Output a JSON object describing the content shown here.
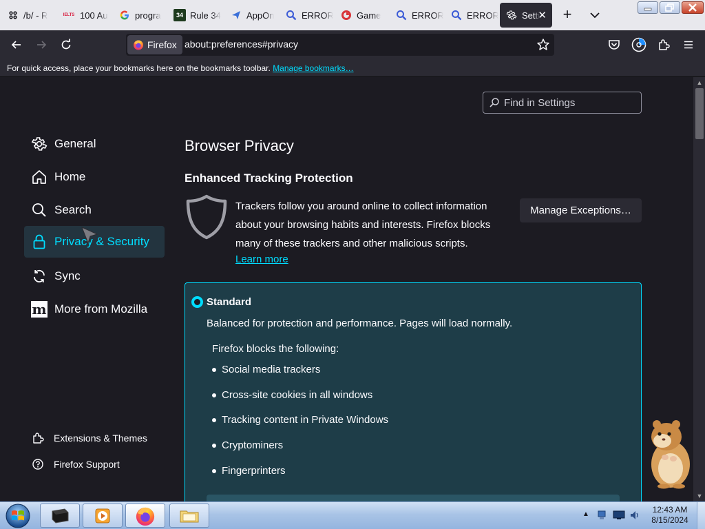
{
  "tabs": [
    {
      "label": "/b/ - R",
      "icon": "fourchan-icon"
    },
    {
      "label": "100 Au",
      "icon": "ielts-icon",
      "icon_text": "IELTS"
    },
    {
      "label": "progra",
      "icon": "google-icon"
    },
    {
      "label": "Rule 34",
      "icon": "rule34-icon",
      "icon_text": "34"
    },
    {
      "label": "AppOn",
      "icon": "send-icon"
    },
    {
      "label": "ERROR",
      "icon": "search-icon"
    },
    {
      "label": "Game",
      "icon": "game-icon"
    },
    {
      "label": "ERROR",
      "icon": "search-icon"
    },
    {
      "label": "ERROR",
      "icon": "search-icon"
    },
    {
      "label": "Setti",
      "icon": "gear-icon",
      "active": true
    }
  ],
  "navbar": {
    "identity_label": "Firefox",
    "url": "about:preferences#privacy"
  },
  "bookmarks_bar": {
    "message": "For quick access, place your bookmarks here on the bookmarks toolbar. ",
    "link": "Manage bookmarks…"
  },
  "search": {
    "placeholder": "Find in Settings"
  },
  "sidebar": {
    "items": [
      {
        "label": "General",
        "icon": "gear-icon"
      },
      {
        "label": "Home",
        "icon": "home-icon"
      },
      {
        "label": "Search",
        "icon": "search-icon"
      },
      {
        "label": "Privacy & Security",
        "icon": "lock-icon",
        "selected": true
      },
      {
        "label": "Sync",
        "icon": "sync-icon"
      },
      {
        "label": "More from Mozilla",
        "icon": "mozilla-icon",
        "icon_text": "m"
      }
    ],
    "footer": [
      {
        "label": "Extensions & Themes",
        "icon": "puzzle-icon"
      },
      {
        "label": "Firefox Support",
        "icon": "help-icon"
      }
    ]
  },
  "main": {
    "heading": "Browser Privacy",
    "etp_heading": "Enhanced Tracking Protection",
    "etp_description": "Trackers follow you around online to collect information about your browsing habits and interests. Firefox blocks many of these trackers and other malicious scripts.",
    "learn_more": "Learn more",
    "manage_exceptions": "Manage Exceptions…",
    "standard": {
      "title": "Standard",
      "description": "Balanced for protection and performance. Pages will load normally.",
      "blocks_title": "Firefox blocks the following:",
      "blocks": [
        "Social media trackers",
        "Cross-site cookies in all windows",
        "Tracking content in Private Windows",
        "Cryptominers",
        "Fingerprinters"
      ]
    }
  },
  "taskbar": {
    "time": "12:43 AM",
    "date": "8/15/2024"
  },
  "colors": {
    "accent": "#00ddff",
    "page_bg": "#1c1b22",
    "toolbar_bg": "#2b2a33",
    "card_bg": "#1e3d48"
  }
}
